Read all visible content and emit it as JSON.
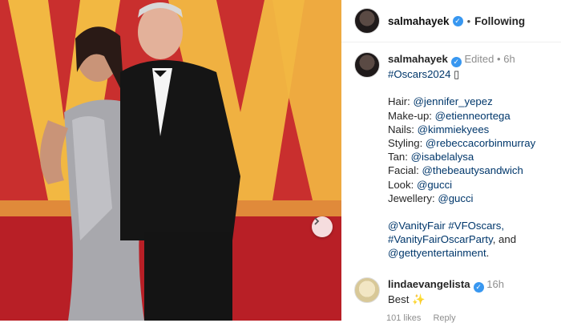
{
  "post": {
    "username": "salmahayek",
    "follow_status": "Following"
  },
  "caption": {
    "username": "salmahayek",
    "edited_label": "Edited",
    "time": "6h",
    "hashtag_line": "#Oscars2024",
    "hashtag_trailing_glyph": "▯",
    "credits": [
      {
        "label": "Hair:",
        "handle": "@jennifer_yepez"
      },
      {
        "label": "Make-up:",
        "handle": "@etienneortega"
      },
      {
        "label": "Nails:",
        "handle": "@kimmiekyees"
      },
      {
        "label": "Styling:",
        "handle": "@rebeccacorbinmurray"
      },
      {
        "label": "Tan:",
        "handle": "@isabelalysa"
      },
      {
        "label": "Facial:",
        "handle": "@thebeautysandwich"
      },
      {
        "label": "Look:",
        "handle": "@gucci"
      },
      {
        "label": "Jewellery:",
        "handle": "@gucci"
      }
    ],
    "footer_line1": "@VanityFair #VFOscars,",
    "footer_line2_tag": "#VanityFairOscarParty",
    "footer_line2_rest": ", and",
    "footer_line3_tag": "@gettyentertainment",
    "footer_line3_rest": "."
  },
  "comment": {
    "username": "lindaevangelista",
    "time": "16h",
    "text": "Best",
    "emoji": "✨",
    "likes": "101 likes",
    "reply": "Reply"
  },
  "colors": {
    "link": "#00376b",
    "verified": "#3897f0",
    "backdrop": "#c4262a",
    "letters": "#f2b842"
  }
}
